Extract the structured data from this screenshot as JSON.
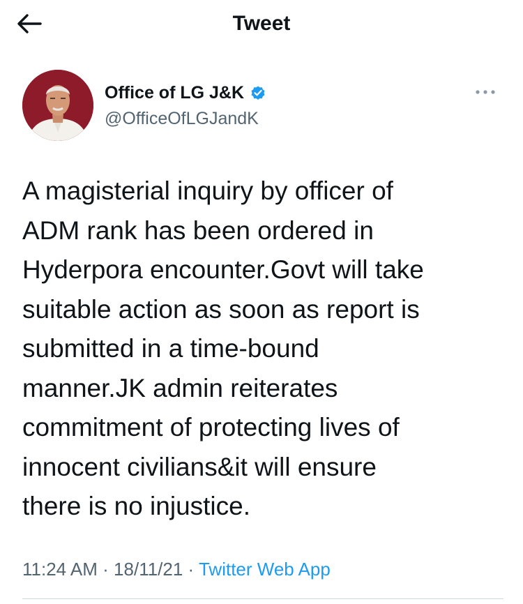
{
  "header": {
    "title": "Tweet",
    "back_icon": "arrow-left-icon"
  },
  "author": {
    "name": "Office of LG J&K",
    "handle": "@OfficeOfLGJandK",
    "verified_icon": "verified-badge-icon",
    "more_icon": "more-horizontal-icon",
    "avatar_bg": "#8e1b2a"
  },
  "tweet": {
    "text": "A magisterial inquiry by officer of\nADM rank has been ordered in\nHyderpora encounter.Govt will take\nsuitable action as soon as report is\nsubmitted in a time-bound\nmanner.JK admin reiterates\ncommitment of protecting lives of\ninnocent civilians&it will ensure\nthere is no injustice."
  },
  "meta": {
    "time": "11:24 AM",
    "sep1": " · ",
    "date": "18/11/21",
    "sep2": " · ",
    "source": "Twitter Web App"
  },
  "colors": {
    "text": "#0f1419",
    "secondary": "#536471",
    "accent": "#1d9bf0"
  }
}
